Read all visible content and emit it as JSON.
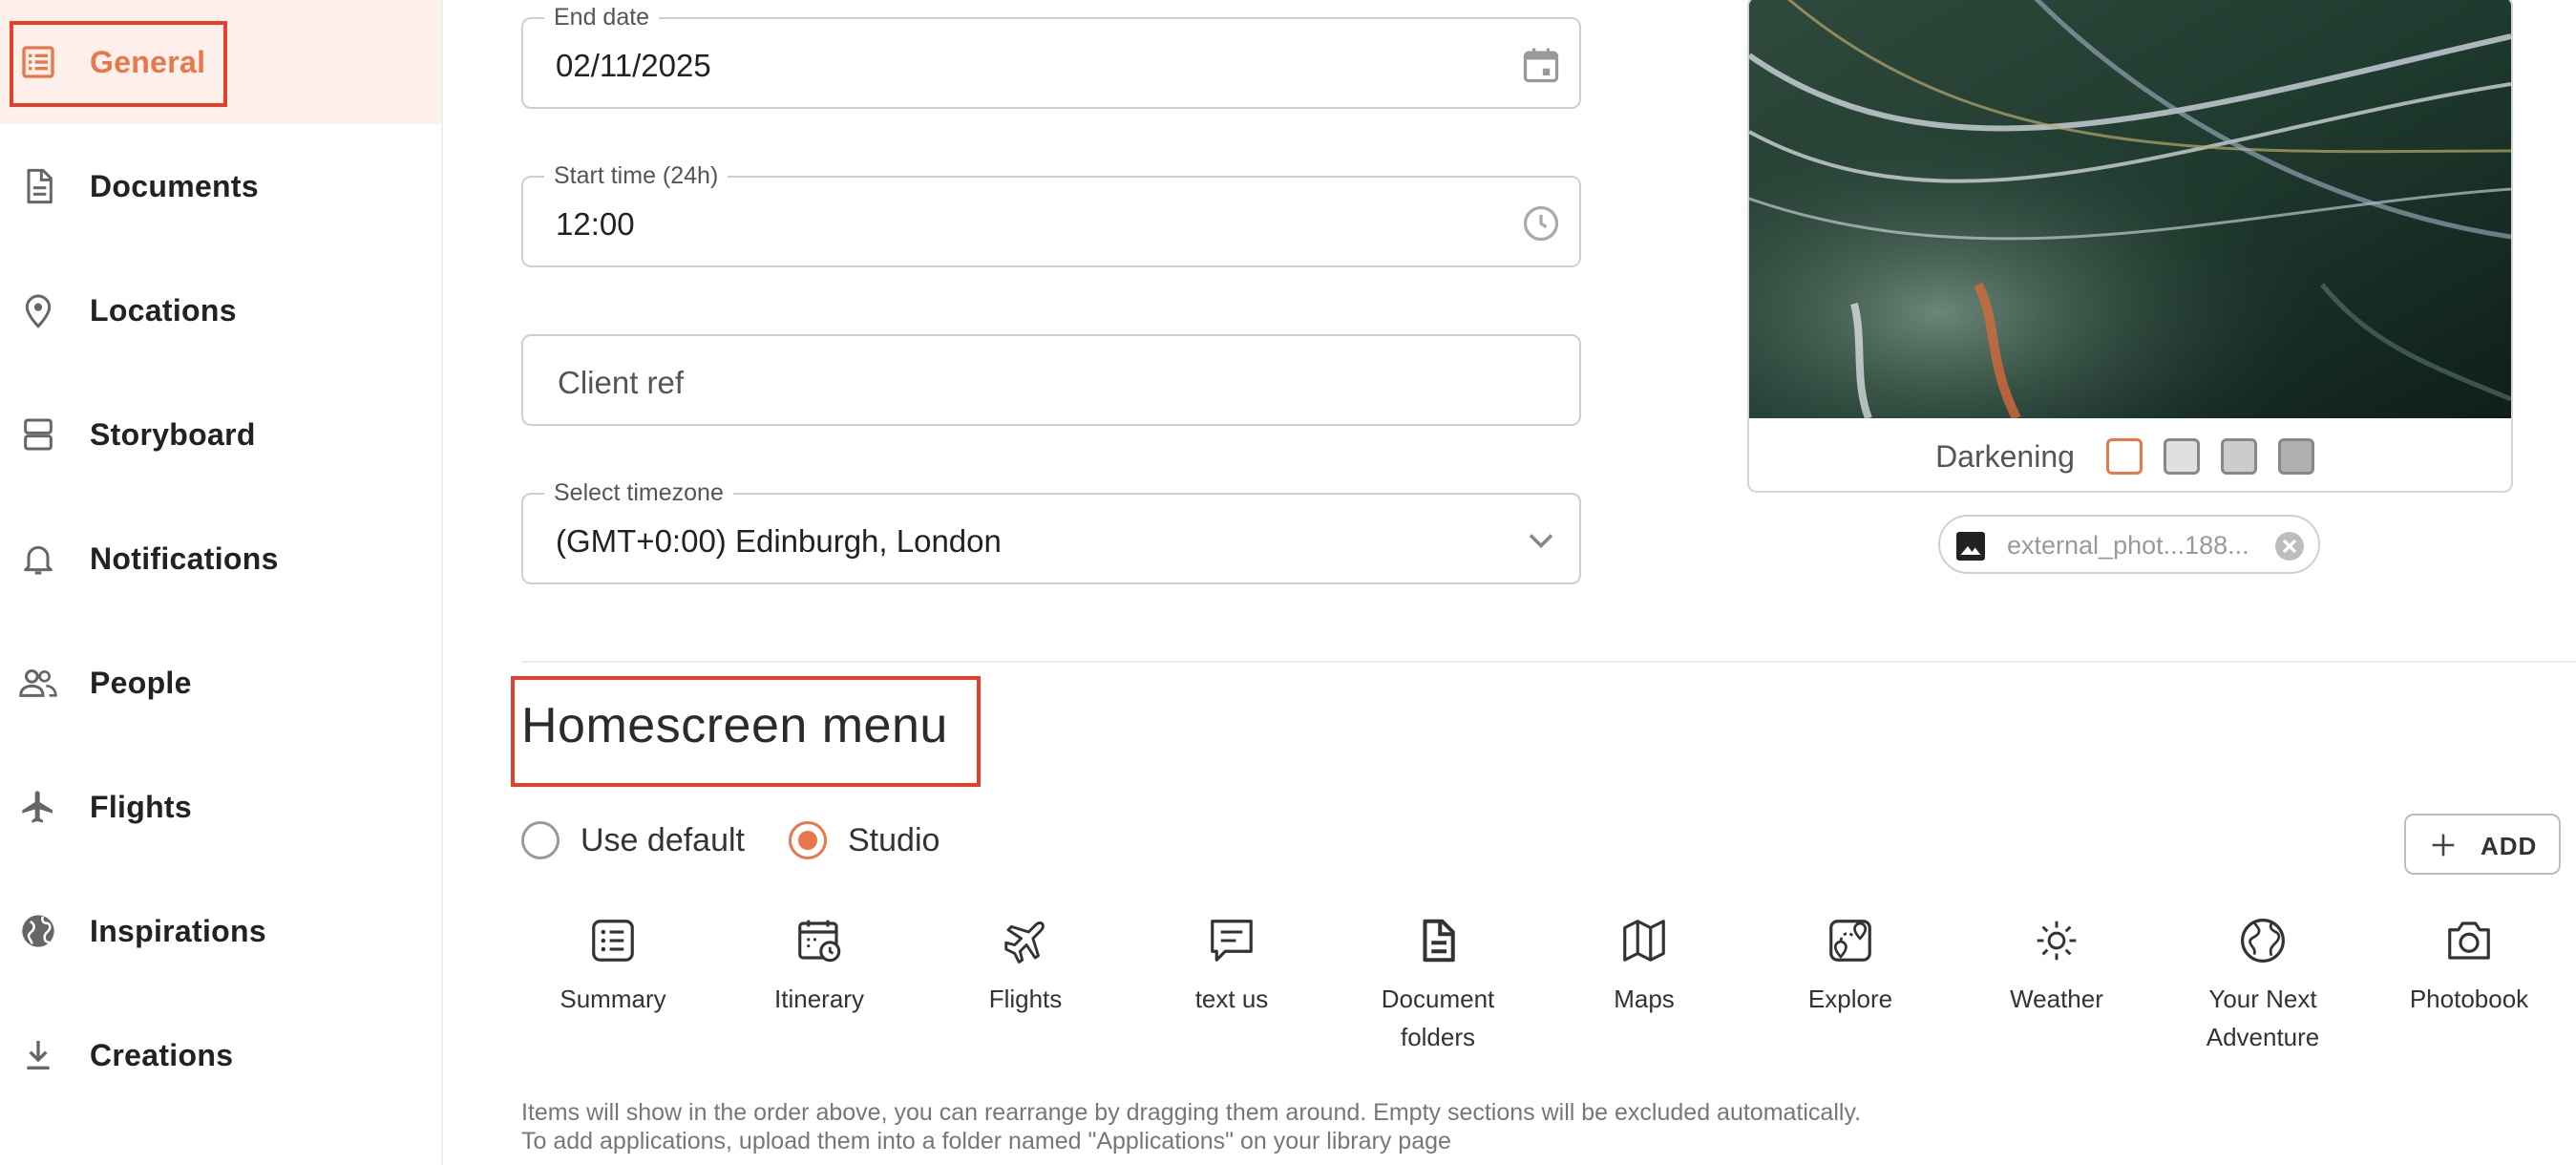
{
  "sidebar": {
    "items": [
      {
        "label": "General",
        "icon": "list-icon",
        "active": true
      },
      {
        "label": "Documents",
        "icon": "document-icon"
      },
      {
        "label": "Locations",
        "icon": "location-pin-icon"
      },
      {
        "label": "Storyboard",
        "icon": "storyboard-icon"
      },
      {
        "label": "Notifications",
        "icon": "bell-icon"
      },
      {
        "label": "People",
        "icon": "people-icon"
      },
      {
        "label": "Flights",
        "icon": "plane-icon"
      },
      {
        "label": "Inspirations",
        "icon": "globe-icon"
      },
      {
        "label": "Creations",
        "icon": "download-icon"
      }
    ],
    "active_color": "#e8784a"
  },
  "form": {
    "end_date": {
      "label": "End date",
      "value": "02/11/2025"
    },
    "start_time": {
      "label": "Start time (24h)",
      "value": "12:00"
    },
    "client_ref": {
      "placeholder": "Client ref"
    },
    "timezone": {
      "label": "Select timezone",
      "value": "(GMT+0:00) Edinburgh, London"
    }
  },
  "image_panel": {
    "darkening_label": "Darkening",
    "swatches": [
      "#ffffff",
      "#e0e0e0",
      "#cccccc",
      "#b0b0b0"
    ],
    "selected_swatch": 0,
    "file_name": "external_phot...188..."
  },
  "homescreen": {
    "title": "Homescreen menu",
    "radio_default": "Use default",
    "radio_studio": "Studio",
    "selected": "Studio",
    "add_label": "ADD",
    "items": [
      {
        "label": "Summary",
        "icon": "summary-list-icon"
      },
      {
        "label": "Itinerary",
        "icon": "calendar-clock-icon"
      },
      {
        "label": "Flights",
        "icon": "plane-icon"
      },
      {
        "label": "text us",
        "icon": "chat-icon"
      },
      {
        "label": "Document folders",
        "icon": "document-icon"
      },
      {
        "label": "Maps",
        "icon": "map-icon"
      },
      {
        "label": "Explore",
        "icon": "explore-map-icon"
      },
      {
        "label": "Weather",
        "icon": "sun-icon"
      },
      {
        "label": "Your Next Adventure",
        "icon": "globe-icon"
      },
      {
        "label": "Photobook",
        "icon": "camera-icon"
      }
    ],
    "help_line1": "Items will show in the order above, you can rearrange by dragging them around. Empty sections will be excluded automatically.",
    "help_line2": "To add applications, upload them into a folder named \"Applications\" on your library page"
  },
  "colors": {
    "accent": "#e8784a",
    "highlight": "#e2412c"
  }
}
